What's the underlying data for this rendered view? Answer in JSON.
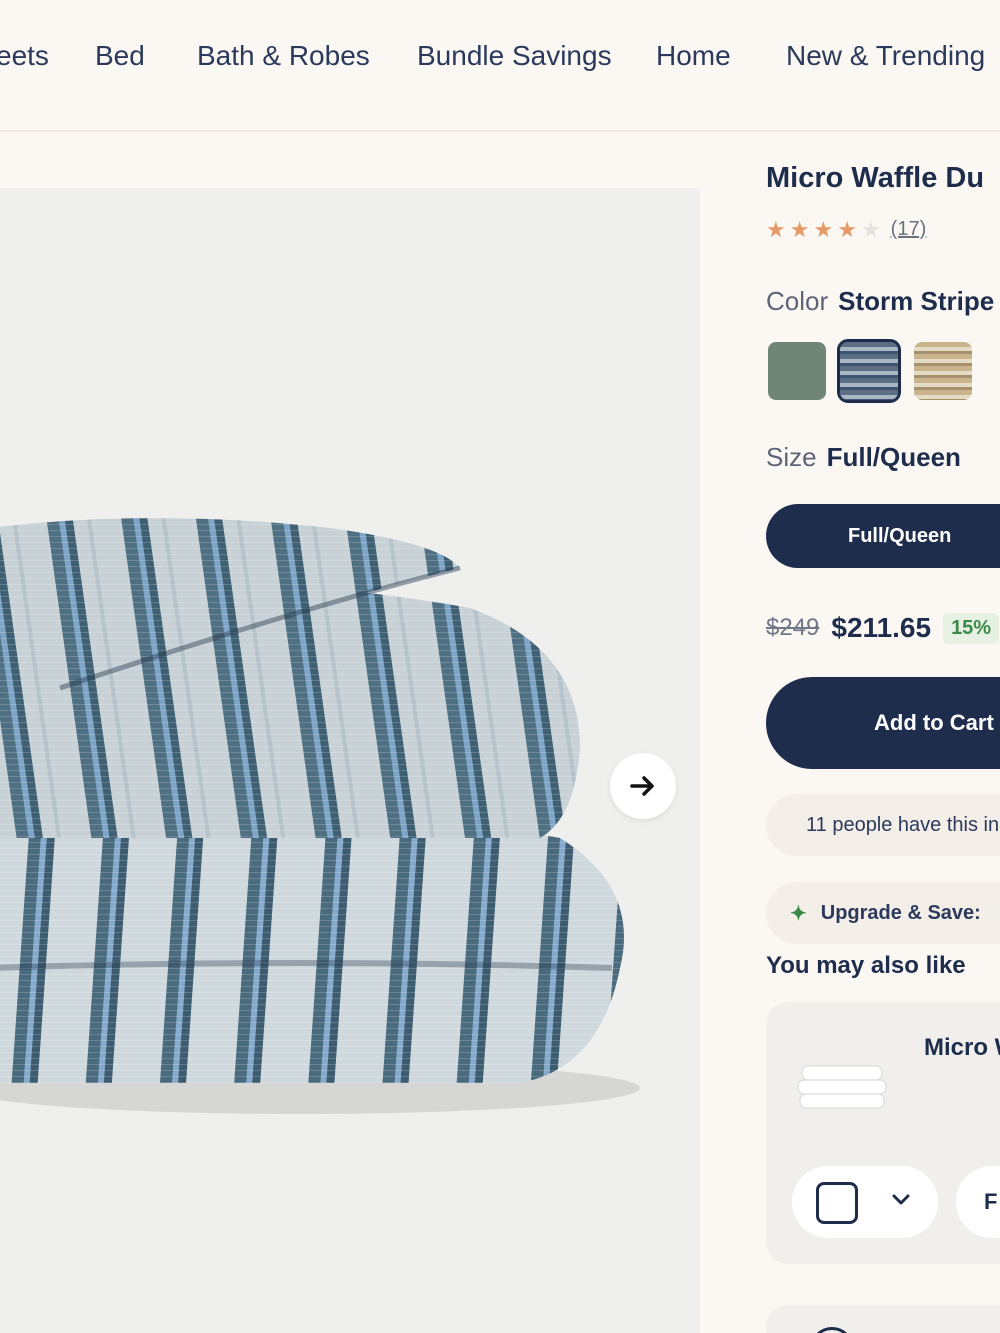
{
  "nav": {
    "items": [
      "eets",
      "Bed",
      "Bath & Robes",
      "Bundle Savings",
      "Home",
      "New & Trending"
    ]
  },
  "product": {
    "title": "Micro Waffle Du",
    "rating": 4,
    "rating_max": 5,
    "review_count": "(17)",
    "color_label": "Color",
    "color_value": "Storm Stripe",
    "swatches": [
      {
        "name": "sage",
        "color": "#6f8677"
      },
      {
        "name": "storm-stripe",
        "color": "#5c6e86",
        "selected": true
      },
      {
        "name": "sand-stripe",
        "color": "#c9b48b"
      }
    ],
    "size_label": "Size",
    "size_value": "Full/Queen",
    "size_option": "Full/Queen",
    "old_price": "$249",
    "price": "$211.65",
    "discount": "15%",
    "add_to_cart": "Add to Cart",
    "social_proof": "11 people have this in",
    "upgrade": "Upgrade & Save:"
  },
  "recommendations": {
    "heading": "You may also like",
    "items": [
      {
        "name": "Micro W",
        "size": "F"
      }
    ]
  },
  "colors": {
    "navy": "#1f2d4d",
    "background": "#fbf8f4",
    "star": "#e59b67",
    "discount_green": "#3c8a4a"
  },
  "icons": {
    "next": "arrow-right-icon",
    "chevron": "chevron-down-icon",
    "sparkle": "sparkle-icon"
  }
}
